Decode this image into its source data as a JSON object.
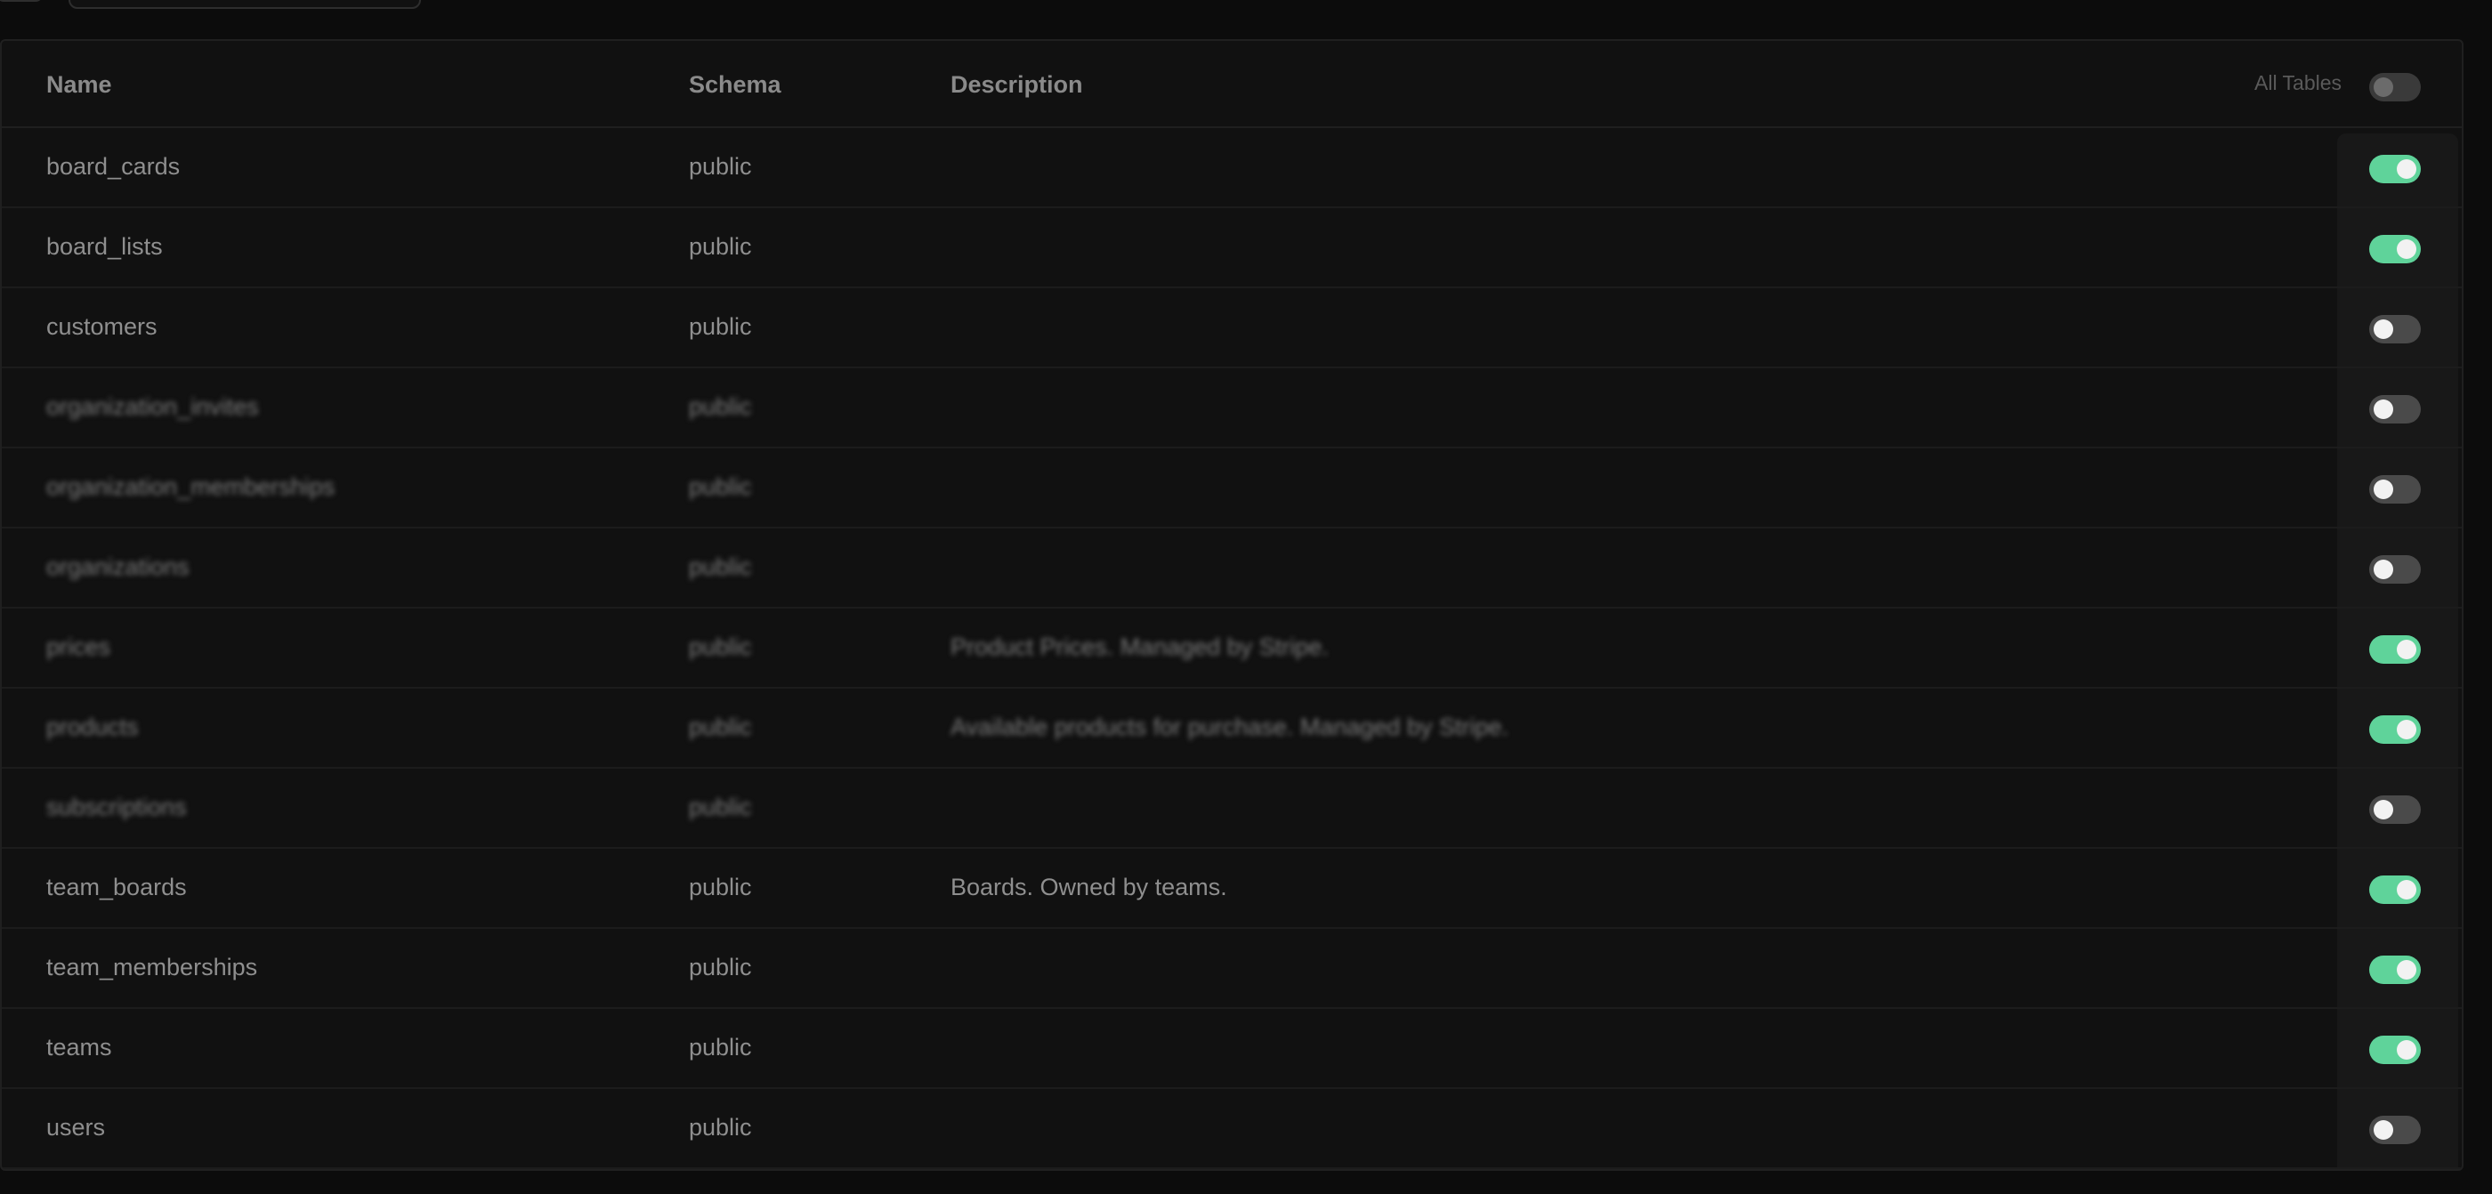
{
  "header": {
    "name_label": "Name",
    "schema_label": "Schema",
    "description_label": "Description",
    "all_tables_label": "All Tables",
    "all_tables_enabled": false
  },
  "tables": [
    {
      "name": "board_cards",
      "schema": "public",
      "description": "",
      "enabled": true
    },
    {
      "name": "board_lists",
      "schema": "public",
      "description": "",
      "enabled": true
    },
    {
      "name": "customers",
      "schema": "public",
      "description": "",
      "enabled": false
    },
    {
      "name": "organization_invites",
      "schema": "public",
      "description": "",
      "enabled": false
    },
    {
      "name": "organization_memberships",
      "schema": "public",
      "description": "",
      "enabled": false
    },
    {
      "name": "organizations",
      "schema": "public",
      "description": "",
      "enabled": false
    },
    {
      "name": "prices",
      "schema": "public",
      "description": "Product Prices. Managed by Stripe.",
      "enabled": true
    },
    {
      "name": "products",
      "schema": "public",
      "description": "Available products for purchase. Managed by Stripe.",
      "enabled": true
    },
    {
      "name": "subscriptions",
      "schema": "public",
      "description": "",
      "enabled": false
    },
    {
      "name": "team_boards",
      "schema": "public",
      "description": "Boards. Owned by teams.",
      "enabled": true
    },
    {
      "name": "team_memberships",
      "schema": "public",
      "description": "",
      "enabled": true
    },
    {
      "name": "teams",
      "schema": "public",
      "description": "",
      "enabled": true
    },
    {
      "name": "users",
      "schema": "public",
      "description": "",
      "enabled": false
    }
  ]
}
